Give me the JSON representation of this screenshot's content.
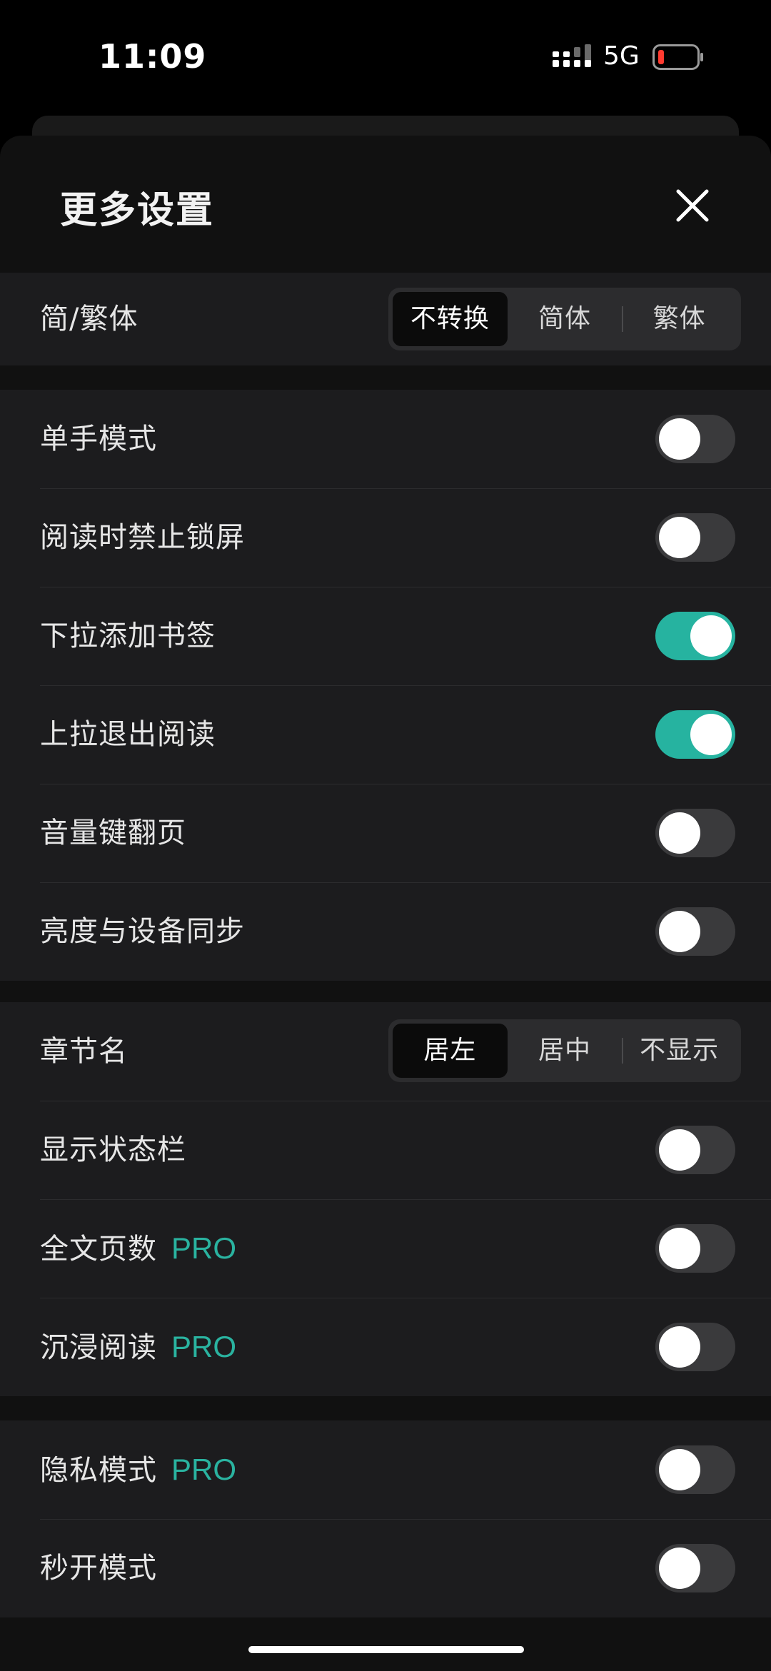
{
  "status_bar": {
    "time": "11:09",
    "network": "5G"
  },
  "header": {
    "title": "更多设置"
  },
  "group1": {
    "label": "简/繁体",
    "options": [
      "不转换",
      "简体",
      "繁体"
    ],
    "selected": "不转换"
  },
  "group2": {
    "rows": [
      {
        "label": "单手模式",
        "on": false
      },
      {
        "label": "阅读时禁止锁屏",
        "on": false
      },
      {
        "label": "下拉添加书签",
        "on": true
      },
      {
        "label": "上拉退出阅读",
        "on": true
      },
      {
        "label": "音量键翻页",
        "on": false
      },
      {
        "label": "亮度与设备同步",
        "on": false
      }
    ]
  },
  "group3": {
    "chapter": {
      "label": "章节名",
      "options": [
        "居左",
        "居中",
        "不显示"
      ],
      "selected": "居左"
    },
    "rows": [
      {
        "label": "显示状态栏",
        "on": false,
        "pro": ""
      },
      {
        "label": "全文页数",
        "on": false,
        "pro": "PRO"
      },
      {
        "label": "沉浸阅读",
        "on": false,
        "pro": "PRO"
      }
    ]
  },
  "group4": {
    "rows": [
      {
        "label": "隐私模式",
        "on": false,
        "pro": "PRO"
      },
      {
        "label": "秒开模式",
        "on": false,
        "pro": ""
      }
    ]
  },
  "colors": {
    "accent": "#26b3a0",
    "toggle_off": "#3a3a3c",
    "group_bg": "#1c1c1e",
    "sheet_bg": "#111111"
  },
  "icons": {
    "close": "close-icon",
    "signal": "signal-icon",
    "battery": "battery-icon"
  }
}
